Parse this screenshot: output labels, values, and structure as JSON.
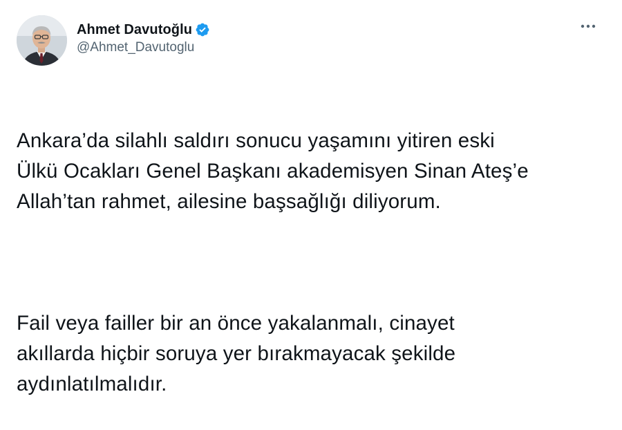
{
  "author": {
    "display_name": "Ahmet Davutoğlu",
    "handle": "@Ahmet_Davutoglu",
    "verified": true
  },
  "icons": {
    "verified": "verified-badge-icon",
    "more": "more-options-icon",
    "accent_color": "#1d9bf0"
  },
  "tweet": {
    "paragraphs": [
      "Ankara’da silahlı saldırı sonucu yaşamını yitiren eski\nÜlkü Ocakları Genel Başkanı akademisyen Sinan Ateş’e\nAllah’tan rahmet, ailesine başsağlığı diliyorum.",
      "Fail veya failler bir an önce yakalanmalı, cinayet\nakıllarda hiçbir soruya yer bırakmayacak şekilde\naydınlatılmalıdır."
    ]
  }
}
